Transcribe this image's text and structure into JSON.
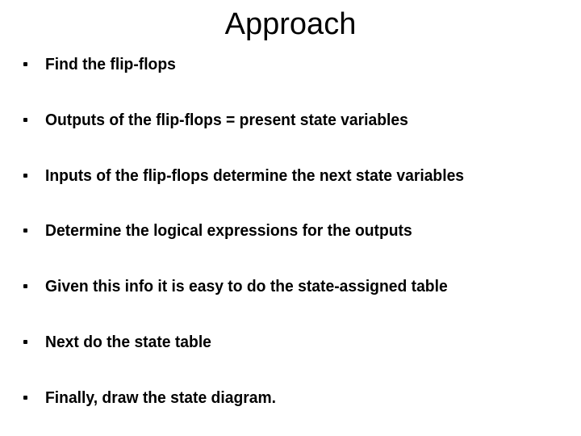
{
  "slide": {
    "title": "Approach",
    "background_color": "#ffffff",
    "text_color": "#000000",
    "bullet_glyph": "square-dot",
    "bullets": [
      {
        "text": "Find the flip-flops"
      },
      {
        "text": "Outputs of the flip-flops = present state variables"
      },
      {
        "text": "Inputs of the flip-flops determine the next state variables"
      },
      {
        "text": "Determine the logical expressions for the outputs"
      },
      {
        "text": "Given this info it is easy to do the state-assigned table"
      },
      {
        "text": "Next do the state table"
      },
      {
        "text": "Finally, draw the state diagram."
      }
    ]
  }
}
